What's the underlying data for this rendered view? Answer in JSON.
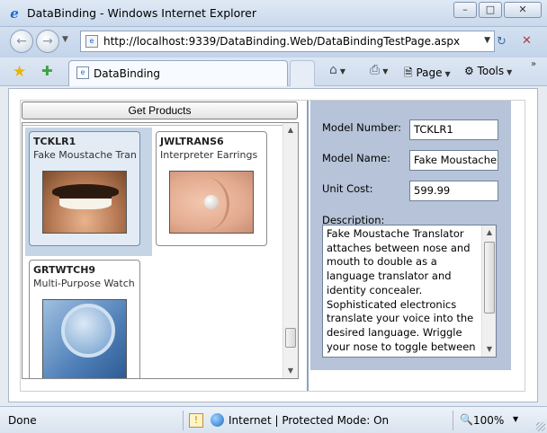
{
  "window": {
    "title": "DataBinding - Windows Internet Explorer",
    "minimize_glyph": "–",
    "maximize_glyph": "□",
    "close_glyph": "✕"
  },
  "navigation": {
    "url": "http://localhost:9339/DataBinding.Web/DataBindingTestPage.aspx"
  },
  "tabs": [
    {
      "label": "DataBinding"
    }
  ],
  "commandbar": {
    "page_label": "Page",
    "tools_label": "Tools"
  },
  "app": {
    "get_products_label": "Get Products",
    "products": [
      {
        "code": "TCKLR1",
        "name": "Fake Moustache Tran",
        "image": "moustache-photo",
        "selected": true
      },
      {
        "code": "JWLTRANS6",
        "name": "Interpreter Earrings",
        "image": "earring-photo",
        "selected": false
      },
      {
        "code": "GRTWTCH9",
        "name": "Multi-Purpose Watch",
        "image": "watch-photo",
        "selected": false
      }
    ],
    "details": {
      "model_number_label": "Model Number:",
      "model_number_value": "TCKLR1",
      "model_name_label": "Model Name:",
      "model_name_value": "Fake Moustache",
      "unit_cost_label": "Unit Cost:",
      "unit_cost_value": "599.99",
      "description_label": "Description:",
      "description_value": "Fake Moustache Translator attaches between nose and mouth to double as a language translator and identity concealer. Sophisticated electronics translate your voice into the desired language. Wriggle your nose to toggle between"
    }
  },
  "statusbar": {
    "status": "Done",
    "zone": "Internet | Protected Mode: On",
    "zoom": "100%"
  },
  "colors": {
    "details_bg": "#b6c3d8",
    "selected_item_bg": "#c5d5e6",
    "divider": "#8aa2c2"
  }
}
